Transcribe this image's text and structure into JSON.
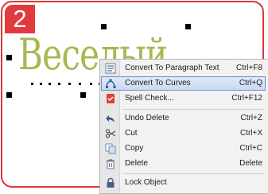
{
  "step": {
    "number": "2"
  },
  "canvas": {
    "text": "Веселый"
  },
  "context_menu": {
    "items": [
      {
        "label": "Convert To Paragraph Text",
        "shortcut": "Ctrl+F8",
        "icon": "paragraph-text-icon"
      },
      {
        "label": "Convert To Curves",
        "shortcut": "Ctrl+Q",
        "icon": "curves-icon",
        "highlighted": true
      },
      {
        "label": "Spell Check...",
        "shortcut": "Ctrl+F12",
        "icon": "spell-check-icon"
      },
      {
        "label": "Undo Delete",
        "shortcut": "Ctrl+Z",
        "icon": "undo-icon"
      },
      {
        "label": "Cut",
        "shortcut": "Ctrl+X",
        "icon": "scissors-icon"
      },
      {
        "label": "Copy",
        "shortcut": "Ctrl+C",
        "icon": "copy-icon"
      },
      {
        "label": "Delete",
        "shortcut": "Delete",
        "icon": "trash-icon"
      },
      {
        "label": "Lock Object",
        "shortcut": "",
        "icon": "lock-icon"
      }
    ]
  },
  "colors": {
    "frame_border": "#d9383a",
    "badge": "#e13a3e",
    "canvas_text": "#a7b84f",
    "menu_highlight_border": "#6a8fc4"
  }
}
